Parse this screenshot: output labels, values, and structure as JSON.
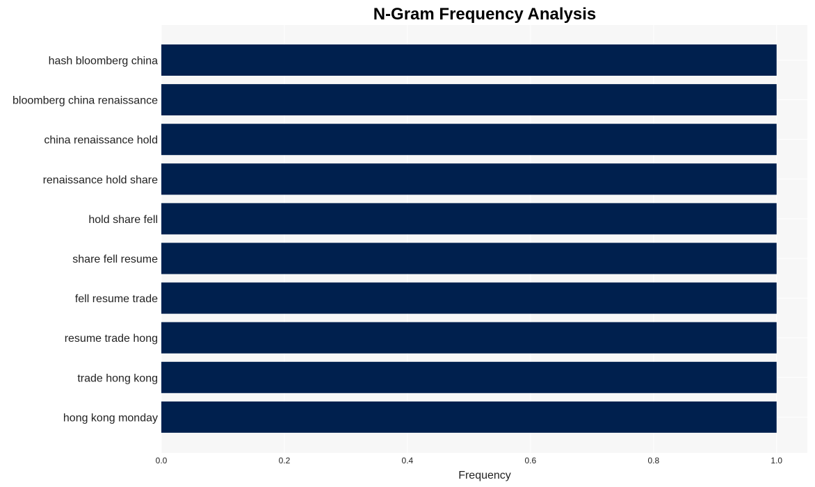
{
  "chart_data": {
    "type": "bar",
    "orientation": "horizontal",
    "title": "N-Gram Frequency Analysis",
    "xlabel": "Frequency",
    "ylabel": "",
    "categories": [
      "hash bloomberg china",
      "bloomberg china renaissance",
      "china renaissance hold",
      "renaissance hold share",
      "hold share fell",
      "share fell resume",
      "fell resume trade",
      "resume trade hong",
      "trade hong kong",
      "hong kong monday"
    ],
    "values": [
      1,
      1,
      1,
      1,
      1,
      1,
      1,
      1,
      1,
      1
    ],
    "xlim": [
      0,
      1.05
    ],
    "xticks": [
      0.0,
      0.2,
      0.4,
      0.6,
      0.8,
      1.0
    ],
    "xtick_labels": [
      "0.0",
      "0.2",
      "0.4",
      "0.6",
      "0.8",
      "1.0"
    ],
    "grid": true,
    "bar_color": "#00204e",
    "background_color": "#f7f7f7",
    "legend": "none"
  }
}
